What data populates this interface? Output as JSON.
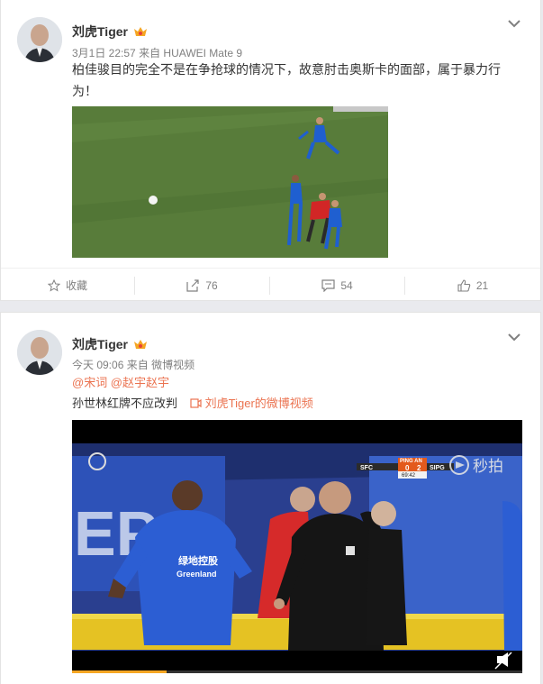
{
  "posts": [
    {
      "author": "刘虎Tiger",
      "time": "3月1日 22:57",
      "source_prefix": "来自",
      "source": "HUAWEI Mate 9",
      "text": "柏佳骏目的完全不是在争抢球的情况下，故意肘击奥斯卡的面部，属于暴力行为！",
      "actions": {
        "favorite": "收藏",
        "repost": "76",
        "comment": "54",
        "like": "21"
      }
    },
    {
      "author": "刘虎Tiger",
      "time": "今天 09:06",
      "source_prefix": "来自",
      "source": "微博视频",
      "mentions": "@宋词 @赵宇赵宇",
      "text": "孙世林红牌不应改判",
      "video_link": "刘虎Tiger的微博视频",
      "video": {
        "score_sponsor": "PING AN",
        "home_team": "SFC",
        "score_home": "0",
        "score_away": "2",
        "away_team": "SIPG",
        "clock": "69:42",
        "watermark": "秒拍",
        "jersey_sponsor": "绿地控股",
        "jersey_sponsor_en": "Greenland",
        "progress": 0.21
      }
    }
  ],
  "colors": {
    "link": "#eb7350",
    "vip_badge": "#f5a623"
  }
}
